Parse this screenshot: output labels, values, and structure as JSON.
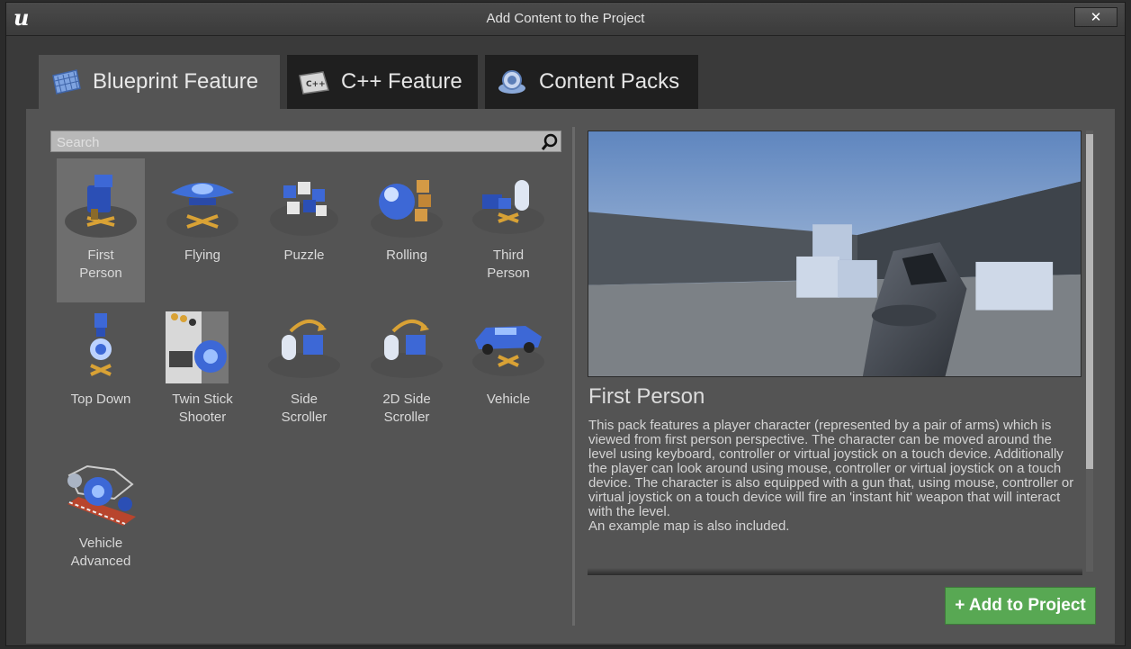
{
  "window": {
    "title": "Add Content to the Project",
    "close_label": "✕"
  },
  "tabs": [
    {
      "label": "Blueprint Feature",
      "icon": "blueprint-icon",
      "active": true
    },
    {
      "label": "C++ Feature",
      "icon": "cpp-icon",
      "active": false
    },
    {
      "label": "Content Packs",
      "icon": "content-pack-icon",
      "active": false
    }
  ],
  "search": {
    "placeholder": "Search",
    "value": ""
  },
  "templates": [
    {
      "label": "First\nPerson",
      "icon": "first-person-icon",
      "selected": true
    },
    {
      "label": "Flying",
      "icon": "flying-icon"
    },
    {
      "label": "Puzzle",
      "icon": "puzzle-icon"
    },
    {
      "label": "Rolling",
      "icon": "rolling-icon"
    },
    {
      "label": "Third\nPerson",
      "icon": "third-person-icon"
    },
    {
      "label": "Top Down",
      "icon": "top-down-icon"
    },
    {
      "label": "Twin Stick\nShooter",
      "icon": "twin-stick-shooter-icon"
    },
    {
      "label": "Side\nScroller",
      "icon": "side-scroller-icon"
    },
    {
      "label": "2D Side\nScroller",
      "icon": "2d-side-scroller-icon"
    },
    {
      "label": "Vehicle",
      "icon": "vehicle-icon"
    },
    {
      "label": "Vehicle\nAdvanced",
      "icon": "vehicle-advanced-icon"
    }
  ],
  "details": {
    "title": "First Person",
    "description_1": "This pack features a player character (represented by a pair of arms) which is viewed from first person perspective. The character can be moved around the level using keyboard, controller or virtual joystick on a touch device. Additionally the player can look around using mouse, controller or virtual joystick on a touch device. The character is also equipped with a gun that, using mouse, controller or virtual joystick on a touch device will fire an 'instant hit' weapon that will interact with the level.",
    "description_2": "An example map is also included."
  },
  "actions": {
    "add_label": "+ Add to Project"
  },
  "colors": {
    "add_button": "#58a853",
    "active_tab": "#545454",
    "inactive_tab": "#1f1f1f"
  }
}
